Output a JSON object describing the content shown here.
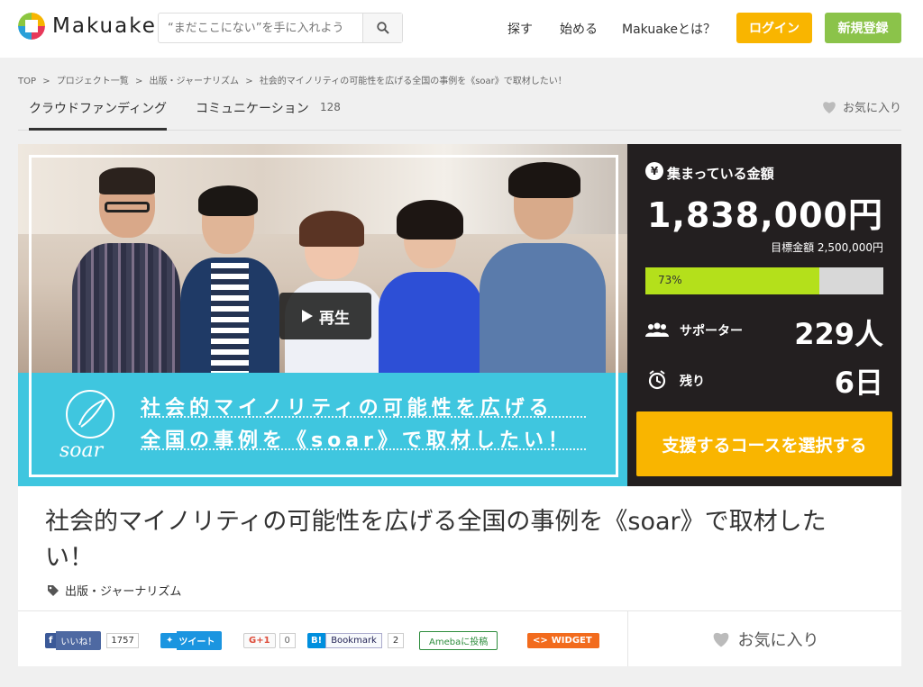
{
  "header": {
    "logo_text": "Makuake",
    "search_placeholder": "“まだここにない”を手に入れよう",
    "nav": [
      "探す",
      "始める",
      "Makuakeとは？"
    ],
    "login_label": "ログイン",
    "signup_label": "新規登録"
  },
  "breadcrumb": [
    "TOP",
    ">",
    "プロジェクト一覧",
    ">",
    "出版・ジャーナリズム",
    ">",
    "社会的マイノリティの可能性を広げる全国の事例を《soar》で取材したい！"
  ],
  "tabs": {
    "crowdfunding": "クラウドファンディング",
    "communication": "コミュニケーション",
    "communication_count": "128",
    "favorite": "お気に入り"
  },
  "hero": {
    "play_label": "再生",
    "banner_line1": "社会的マイノリティの可能性を広げる",
    "banner_line2": "全国の事例を《soar》で取材したい！",
    "logo_text": "soar"
  },
  "funding": {
    "raised_label": "集まっている金額",
    "raised_amount": "1,838,000円",
    "goal_text": "目標金額 2,500,000円",
    "progress_text": "73%",
    "progress_fraction": 0.73,
    "supporters_label": "サポーター",
    "supporters_value": "229人",
    "remaining_label": "残り",
    "remaining_value": "6日",
    "cta_label": "支援するコースを選択する"
  },
  "project": {
    "title": "社会的マイノリティの可能性を広げる全国の事例を《soar》で取材したい！",
    "category": "出版・ジャーナリズム"
  },
  "social": {
    "fb_label": "いいね！",
    "fb_count": "1757",
    "tweet_label": "ツイート",
    "gplus_label": "G+1",
    "gplus_count": "0",
    "hatena_label": "Bookmark",
    "hatena_count": "2",
    "ameba_label": "Amebaに投稿",
    "widget_label": "WIDGET",
    "favorite_label": "お気に入り"
  },
  "colors": {
    "accent_yellow": "#f9b500",
    "signup_green": "#8bc34a",
    "progress_green": "#b4e01b",
    "banner_cyan": "#3fc6df",
    "panel_dark": "#231f20"
  }
}
